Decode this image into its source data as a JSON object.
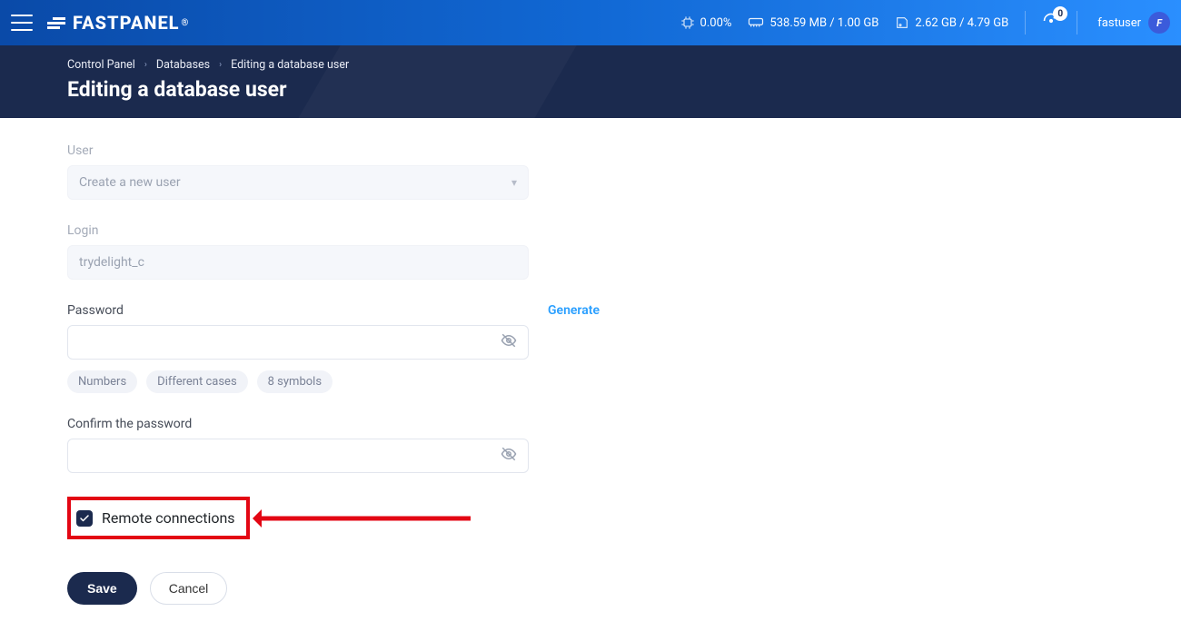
{
  "topbar": {
    "brand": "FASTPANEL",
    "brand_mark": "®",
    "cpu": "0.00%",
    "ram": "538.59 MB / 1.00 GB",
    "disk": "2.62 GB / 4.79 GB",
    "notif_count": "0",
    "username": "fastuser",
    "avatar_letter": "F"
  },
  "breadcrumb": {
    "a": "Control Panel",
    "b": "Databases",
    "c": "Editing a database user"
  },
  "page_title": "Editing a database user",
  "form": {
    "user_label": "User",
    "user_value": "Create a new user",
    "login_label": "Login",
    "login_value": "trydelight_c",
    "password_label": "Password",
    "generate": "Generate",
    "rule_numbers": "Numbers",
    "rule_cases": "Different cases",
    "rule_symbols": "8 symbols",
    "confirm_label": "Confirm the password",
    "remote_label": "Remote connections",
    "save": "Save",
    "cancel": "Cancel"
  }
}
